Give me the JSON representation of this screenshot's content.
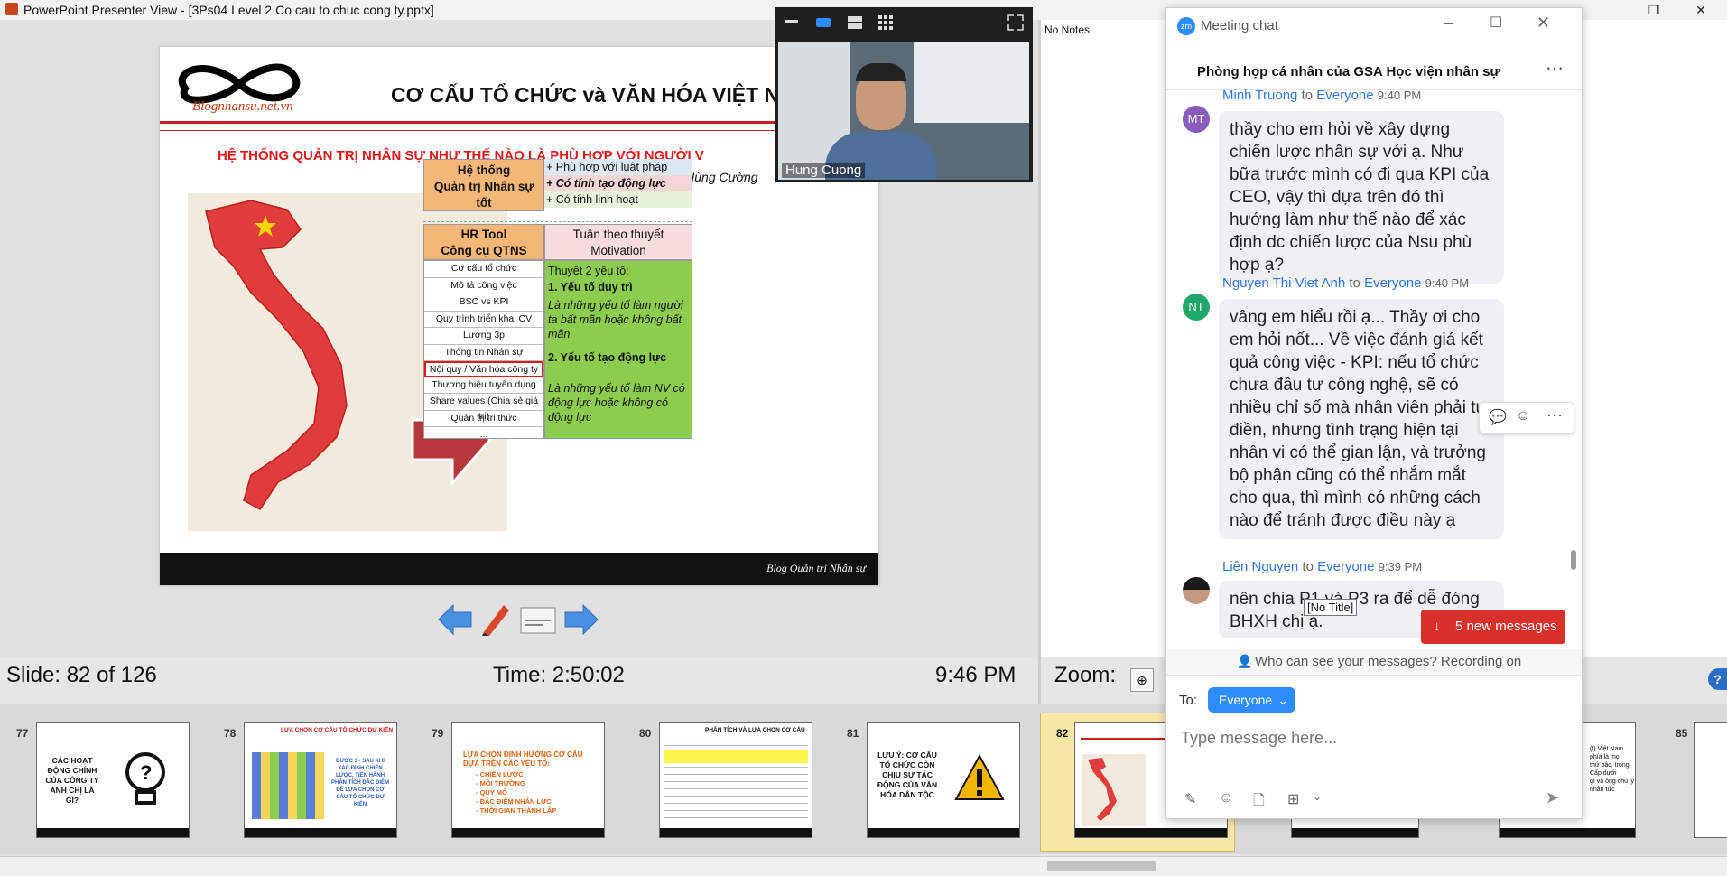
{
  "window": {
    "title": "PowerPoint Presenter View - [3Ps04 Level 2 Co cau to chuc cong ty.pptx]"
  },
  "slide": {
    "title": "CƠ CẤU TỔ CHỨC và VĂN HÓA VIỆT NA",
    "logo_text": "Blognhansu.net.vn",
    "subtitle": "HỆ THỐNG QUẢN TRỊ NHÂN SỰ NHƯ THẾ NÀO LÀ PHÙ HỢP VỚI NGƯỜI V",
    "author": "Nguyễn Hùng Cường",
    "header_box": [
      "Hệ thống",
      "Quản trị Nhân sự",
      "tốt"
    ],
    "header_points": [
      "+ Phù hợp với luật pháp",
      "+ Có tính tạo động lực",
      "+ Có tính linh hoạt"
    ],
    "hr_tool_header": [
      "HR Tool",
      "Công cụ QTNS"
    ],
    "motivation_header": [
      "Tuân theo thuyết",
      "Motivation"
    ],
    "tools": [
      "Cơ cấu tổ chức",
      "Mô tả công việc",
      "BSC vs KPI",
      "Quy trình triển khai CV",
      "Lương 3p",
      "Thông tin Nhân sự",
      "Nội quy / Văn hóa công ty",
      "Thương hiệu tuyển dụng",
      "Share values (Chia sẻ giá trị)",
      "Quản trị tri thức",
      "..."
    ],
    "motivation_text": {
      "intro": "Thuyết 2 yếu tố:",
      "f1": "1. Yếu tố duy trì",
      "f1_desc": "Là những yếu tố làm người ta bất mãn hoặc không bất mãn",
      "f2": "2. Yếu tố tạo động lực",
      "f2_desc": "Là những yếu tố làm NV có động lực hoặc không có động lực"
    },
    "footer": "Blog Quản trị Nhân sự"
  },
  "status": {
    "slide": "Slide: 82 of 126",
    "time": "Time: 2:50:02",
    "clock": "9:46 PM",
    "zoom": "Zoom:"
  },
  "notes": {
    "text": "No Notes."
  },
  "video": {
    "participant": "Hung Cuong"
  },
  "thumbnails": [
    {
      "num": "77",
      "text": "CÁC HOẠT ĐỘNG CHÍNH CỦA CÔNG TY ANH CHỊ LÀ GÌ?"
    },
    {
      "num": "78",
      "text": "LỰA CHỌN CƠ CẤU TỔ CHỨC DỰ KIẾN"
    },
    {
      "num": "79",
      "text": "LỰA CHỌN ĐỊNH HƯỚNG CƠ CẤU DỰA TRÊN CÁC YẾU TỐ:"
    },
    {
      "num": "80",
      "text": "PHÂN TÍCH VÀ LỰA CHỌN CƠ CẤU"
    },
    {
      "num": "81",
      "text": "LƯU Ý: CƠ CẤU TỔ CHỨC CÒN CHỊU SỰ TÁC ĐỘNG CỦA VĂN HÓA DÂN TỘC"
    },
    {
      "num": "82",
      "text": ""
    },
    {
      "num": "85",
      "text": ""
    }
  ],
  "thumb79_items": [
    "- CHIẾN LƯỢC",
    "- MÔI TRƯỜNG",
    "- QUY MÔ",
    "- ĐẶC ĐIỂM NHÂN LỰC",
    "- THỜI GIAN THÀNH LẬP"
  ],
  "thumb78_side": "BƯỚC 3 - SAU KHI XÁC ĐỊNH CHIẾN LƯỢC, TIẾN HÀNH PHÂN TÍCH ĐẶC ĐIỂM ĐỂ LỰA CHỌN CƠ CẤU TỔ CHỨC DỰ KIẾN",
  "thumb_right_text": "(t) Việt Nam\nphía là mọi\nthứ bậc, trong\nCấp dưới\ngì và ông chủ lý\nnhân tức",
  "chat": {
    "app_title": "Meeting chat",
    "room": "Phòng họp cá nhân của GSA Học viện nhân sự",
    "messages": [
      {
        "initials": "MT",
        "sender": "Minh Truong",
        "to": "to",
        "recipient": "Everyone",
        "time": "9:40 PM",
        "text": "thầy cho em hỏi về xây dựng chiến lược nhân sự với ạ. Như bữa trước mình có đi qua KPI của CEO, vậy thì dựa trên đó thì hướng làm như thế nào để xác định dc chiến lược của Nsu phù hợp ạ?"
      },
      {
        "initials": "NT",
        "sender": "Nguyen Thi Viet Anh",
        "to": "to",
        "recipient": "Everyone",
        "time": "9:40 PM",
        "text": "vâng em hiểu rồi ạ... Thầy ơi cho em hỏi nốt... Về việc đánh giá kết quả công việc - KPI: nếu tổ chức chưa đầu tư công nghệ, sẽ có nhiều chỉ số mà nhân viên phải tự điền, nhưng tình trạng hiện tại nhân vi có thể gian lận, và trưởng bộ phận cũng có thể nhắm mắt cho qua, thì mình có những cách nào để tránh được điều này ạ"
      },
      {
        "initials": "",
        "sender": "Liên Nguyen",
        "to": "to",
        "recipient": "Everyone",
        "time": "9:39 PM",
        "text": "nên chia P1 và P3 ra để dễ đóng BHXH chị ạ."
      }
    ],
    "tooltip": "[No Title]",
    "new_messages": "5 new messages",
    "privacy": "Who can see your messages? Recording on",
    "to_label": "To:",
    "recipient_select": "Everyone",
    "input_placeholder": "Type message here..."
  }
}
